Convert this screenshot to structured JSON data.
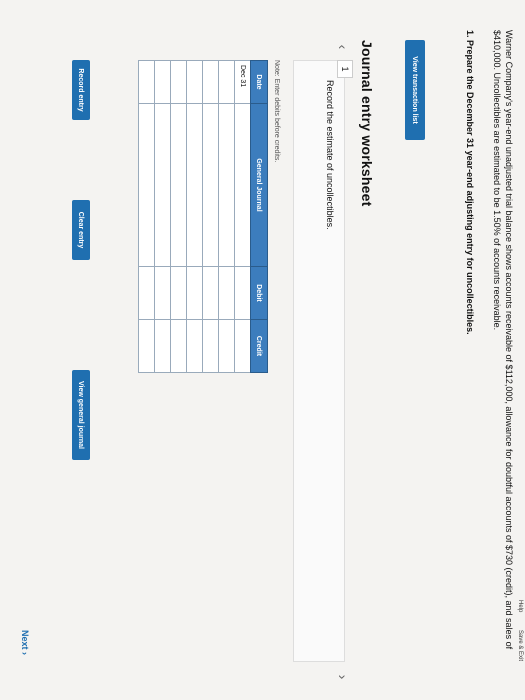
{
  "header": {
    "help": "Help",
    "save_exit": "Save & Exit"
  },
  "problem": {
    "text": "Warner Company's year-end unadjusted trial balance shows accounts receivable of $112,000, allowance for doubtful accounts of $730 (credit), and sales of $410,000. Uncollectibles are estimated to be 1.50% of accounts receivable.",
    "requirement": "1. Prepare the December 31 year-end adjusting entry for uncollectibles."
  },
  "buttons": {
    "view_transactions": "View transaction list",
    "record_entry": "Record entry",
    "clear_entry": "Clear entry",
    "view_journal": "View general journal"
  },
  "worksheet": {
    "title": "Journal entry worksheet",
    "page": "1",
    "instruction": "Record the estimate of uncollectibles.",
    "note": "Note: Enter debits before credits."
  },
  "journal": {
    "columns": [
      "Date",
      "General Journal",
      "Debit",
      "Credit"
    ],
    "first_date": "Dec 31"
  },
  "footer": {
    "next": "Next"
  }
}
